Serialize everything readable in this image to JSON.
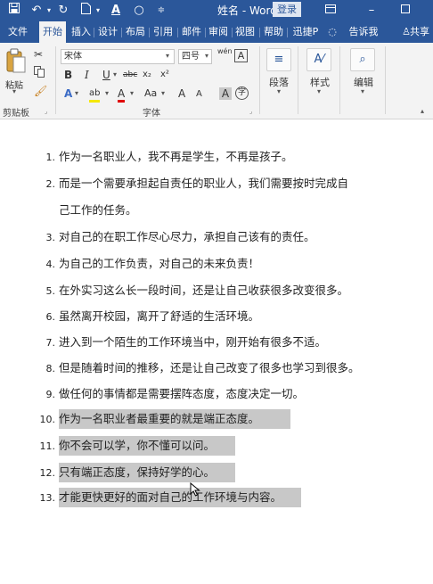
{
  "titlebar": {
    "title": "姓名 - Word",
    "login_label": "登录",
    "icons": [
      "save-icon",
      "undo-icon",
      "redo-icon",
      "new-doc-icon",
      "font-color-icon",
      "shape-icon",
      "customize-icon",
      "ribbon-options-icon",
      "restore-icon"
    ]
  },
  "tabs": [
    {
      "label": "文件"
    },
    {
      "label": "开始"
    },
    {
      "label": "插入"
    },
    {
      "label": "设计"
    },
    {
      "label": "布局"
    },
    {
      "label": "引用"
    },
    {
      "label": "邮件"
    },
    {
      "label": "审阅"
    },
    {
      "label": "视图"
    },
    {
      "label": "帮助"
    },
    {
      "label": "迅捷P"
    },
    {
      "label": "告诉我"
    },
    {
      "label": "共享"
    }
  ],
  "ribbon": {
    "clipboard": {
      "paste_label": "粘贴",
      "group_label": "剪贴板"
    },
    "font": {
      "font_name": "宋体",
      "font_size": "四号",
      "wen_label": "wén",
      "group_label": "字体",
      "buttons": {
        "bold": "B",
        "italic": "I",
        "underline": "U",
        "strike": "abc",
        "subscript": "x₂",
        "superscript": "x²",
        "effects": "A",
        "highlight": "ab",
        "font_color": "A",
        "case": "Aa",
        "grow": "A",
        "shrink": "A",
        "charshade": "A",
        "circle": "字"
      }
    },
    "paragraph": {
      "label": "段落"
    },
    "styles": {
      "label": "样式"
    },
    "editing": {
      "label": "编辑"
    }
  },
  "document": {
    "lines": [
      {
        "num": "1.",
        "text": "作为一名职业人，我不再是学生，不再是孩子。"
      },
      {
        "num": "2.",
        "text": "而是一个需要承担起自责任的职业人，我们需要按时完成自"
      },
      {
        "num": "",
        "text": "己工作的任务。"
      },
      {
        "num": "3.",
        "text": "对自己的在职工作尽心尽力，承担自己该有的责任。"
      },
      {
        "num": "4.",
        "text": "为自己的工作负责，对自己的未来负责！"
      },
      {
        "num": "5.",
        "text": "在外实习这么长一段时间，还是让自己收获很多改变很多。"
      },
      {
        "num": "6.",
        "text": "虽然离开校园，离开了舒适的生活环境。"
      },
      {
        "num": "7.",
        "text": "进入到一个陌生的工作环境当中，刚开始有很多不适。"
      },
      {
        "num": "8.",
        "text": "但是随着时间的推移，还是让自己改变了很多也学习到很多。"
      },
      {
        "num": "9.",
        "text": "做任何的事情都是需要摆阵态度，态度决定一切。"
      },
      {
        "num": "10.",
        "text": "作为一名职业者最重要的就是端正态度。"
      },
      {
        "num": "11.",
        "text": "你不会可以学，你不懂可以问。"
      },
      {
        "num": "12.",
        "text": "只有端正态度，保持好学的心。"
      },
      {
        "num": "13.",
        "text": "才能更快更好的面对自己的工作环境与内容。"
      }
    ]
  }
}
